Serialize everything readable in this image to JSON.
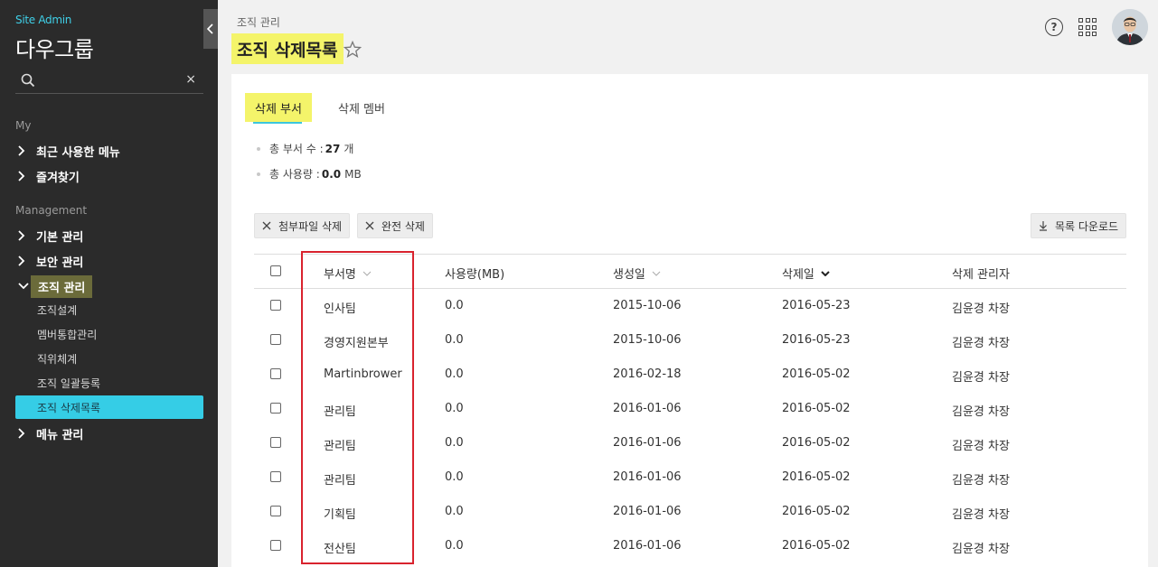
{
  "sidebar": {
    "site_label": "Site Admin",
    "org_name": "다우그룹",
    "search_placeholder": "",
    "search_clear": "×",
    "sections": [
      {
        "label": "My"
      },
      {
        "label": "Management"
      }
    ],
    "my_items": [
      {
        "label": "최근 사용한 메뉴"
      },
      {
        "label": "즐겨찾기"
      }
    ],
    "mgmt_items": [
      {
        "label": "기본 관리"
      },
      {
        "label": "보안 관리"
      },
      {
        "label": "조직 관리"
      },
      {
        "label": "메뉴 관리"
      }
    ],
    "sub_items": [
      {
        "label": "조직설계"
      },
      {
        "label": "멤버통합관리"
      },
      {
        "label": "직위체계"
      },
      {
        "label": "조직 일괄등록"
      },
      {
        "label": "조직 삭제목록"
      }
    ]
  },
  "header": {
    "breadcrumb": "조직 관리",
    "title": "조직 삭제목록",
    "help_label": "?"
  },
  "tabs": [
    {
      "label": "삭제 부서"
    },
    {
      "label": "삭제 멤버"
    }
  ],
  "stats": {
    "dept_count_label": "총 부서 수 :",
    "dept_count_value": "27",
    "dept_count_unit": "개",
    "usage_label": "총 사용량 :",
    "usage_value": "0.0",
    "usage_unit": "MB"
  },
  "toolbar": {
    "delete_attachments": "첨부파일 삭제",
    "delete_complete": "완전 삭제",
    "download_list": "목록 다운로드"
  },
  "table": {
    "headers": {
      "name": "부서명",
      "usage": "사용량(MB)",
      "created": "생성일",
      "deleted": "삭제일",
      "admin": "삭제 관리자"
    },
    "rows": [
      {
        "name": "인사팀",
        "usage": "0.0",
        "created": "2015-10-06",
        "deleted": "2016-05-23",
        "admin": "김윤경 차장"
      },
      {
        "name": "경영지원본부",
        "usage": "0.0",
        "created": "2015-10-06",
        "deleted": "2016-05-23",
        "admin": "김윤경 차장"
      },
      {
        "name": "Martinbrower",
        "usage": "0.0",
        "created": "2016-02-18",
        "deleted": "2016-05-02",
        "admin": "김윤경 차장"
      },
      {
        "name": "관리팀",
        "usage": "0.0",
        "created": "2016-01-06",
        "deleted": "2016-05-02",
        "admin": "김윤경 차장"
      },
      {
        "name": "관리팀",
        "usage": "0.0",
        "created": "2016-01-06",
        "deleted": "2016-05-02",
        "admin": "김윤경 차장"
      },
      {
        "name": "관리팀",
        "usage": "0.0",
        "created": "2016-01-06",
        "deleted": "2016-05-02",
        "admin": "김윤경 차장"
      },
      {
        "name": "기획팀",
        "usage": "0.0",
        "created": "2016-01-06",
        "deleted": "2016-05-02",
        "admin": "김윤경 차장"
      },
      {
        "name": "전산팀",
        "usage": "0.0",
        "created": "2016-01-06",
        "deleted": "2016-05-02",
        "admin": "김윤경 차장"
      }
    ]
  },
  "colors": {
    "accent": "#35cde6",
    "highlight": "#f4f46a",
    "sidebar_bg": "#2b2b2b",
    "annotation_box": "#d9232e"
  }
}
